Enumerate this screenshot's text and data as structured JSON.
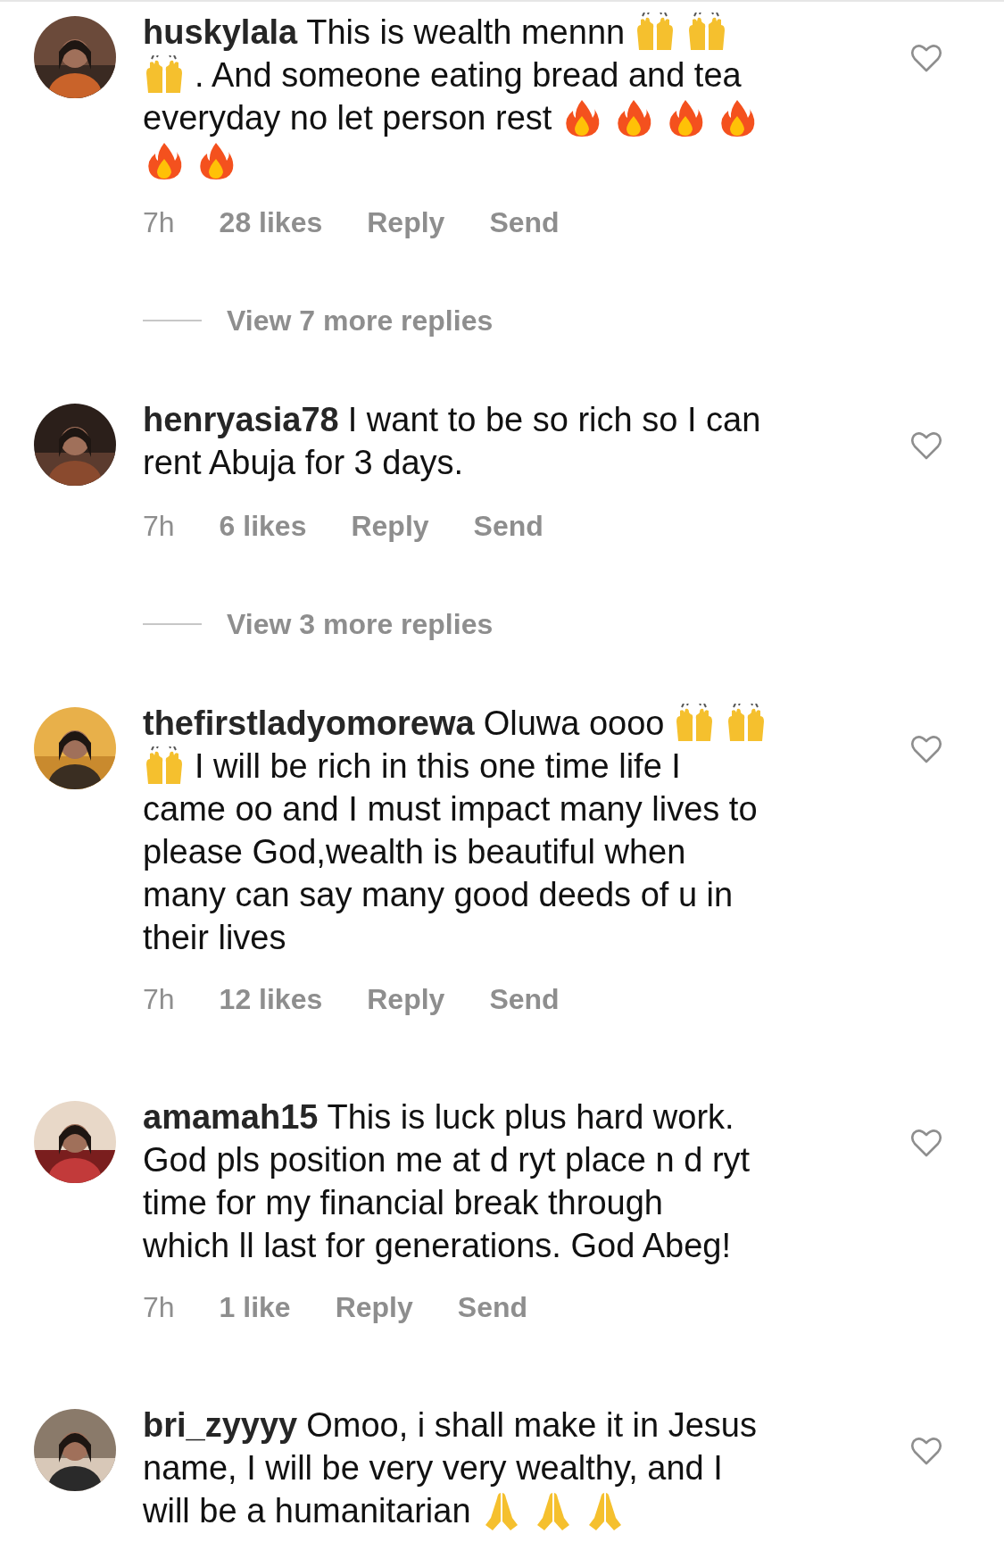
{
  "comments": [
    {
      "username": "huskylala",
      "lines": [
        [
          {
            "kind": "text",
            "text": "This is wealth mennn"
          },
          {
            "kind": "raised-hands"
          },
          {
            "kind": "raised-hands"
          }
        ],
        [
          {
            "kind": "raised-hands"
          },
          {
            "kind": "text",
            "text": ". And someone eating bread and tea"
          }
        ],
        [
          {
            "kind": "text",
            "text": "everyday no let person rest"
          },
          {
            "kind": "fire"
          },
          {
            "kind": "fire"
          },
          {
            "kind": "fire"
          },
          {
            "kind": "fire"
          }
        ],
        [
          {
            "kind": "fire"
          },
          {
            "kind": "fire"
          }
        ]
      ],
      "meta": {
        "time": "7h",
        "likes": "28 likes",
        "reply": "Reply",
        "send": "Send"
      },
      "view_replies": "View 7 more replies"
    },
    {
      "username": "henryasia78",
      "lines": [
        [
          {
            "kind": "text",
            "text": "I want to be so rich so I can"
          }
        ],
        [
          {
            "kind": "text",
            "text": "rent Abuja for 3 days."
          }
        ]
      ],
      "meta": {
        "time": "7h",
        "likes": "6 likes",
        "reply": "Reply",
        "send": "Send"
      },
      "view_replies": "View 3 more replies"
    },
    {
      "username": "thefirstladyomorewa",
      "lines": [
        [
          {
            "kind": "text",
            "text": "Oluwa oooo"
          },
          {
            "kind": "raised-hands"
          },
          {
            "kind": "raised-hands"
          }
        ],
        [
          {
            "kind": "raised-hands"
          },
          {
            "kind": "text",
            "text": "I will be rich in this one time life I"
          }
        ],
        [
          {
            "kind": "text",
            "text": "came oo and I must impact many lives to"
          }
        ],
        [
          {
            "kind": "text",
            "text": "please God,wealth is beautiful when"
          }
        ],
        [
          {
            "kind": "text",
            "text": "many can say many good deeds of u in"
          }
        ],
        [
          {
            "kind": "text",
            "text": "their lives"
          }
        ]
      ],
      "meta": {
        "time": "7h",
        "likes": "12 likes",
        "reply": "Reply",
        "send": "Send"
      }
    },
    {
      "username": "amamah15",
      "lines": [
        [
          {
            "kind": "text",
            "text": "This is luck plus hard work."
          }
        ],
        [
          {
            "kind": "text",
            "text": "God pls position me at d ryt place n d ryt"
          }
        ],
        [
          {
            "kind": "text",
            "text": "time for my financial break through"
          }
        ],
        [
          {
            "kind": "text",
            "text": "which ll last for generations. God Abeg!"
          }
        ]
      ],
      "meta": {
        "time": "7h",
        "likes": "1 like",
        "reply": "Reply",
        "send": "Send"
      }
    },
    {
      "username": "bri_zyyyy",
      "lines": [
        [
          {
            "kind": "text",
            "text": "Omoo, i shall make it in Jesus"
          }
        ],
        [
          {
            "kind": "text",
            "text": "name, I will be very very wealthy, and I"
          }
        ],
        [
          {
            "kind": "text",
            "text": "will be a humanitarian"
          },
          {
            "kind": "pray"
          },
          {
            "kind": "pray"
          },
          {
            "kind": "pray"
          }
        ]
      ]
    }
  ]
}
